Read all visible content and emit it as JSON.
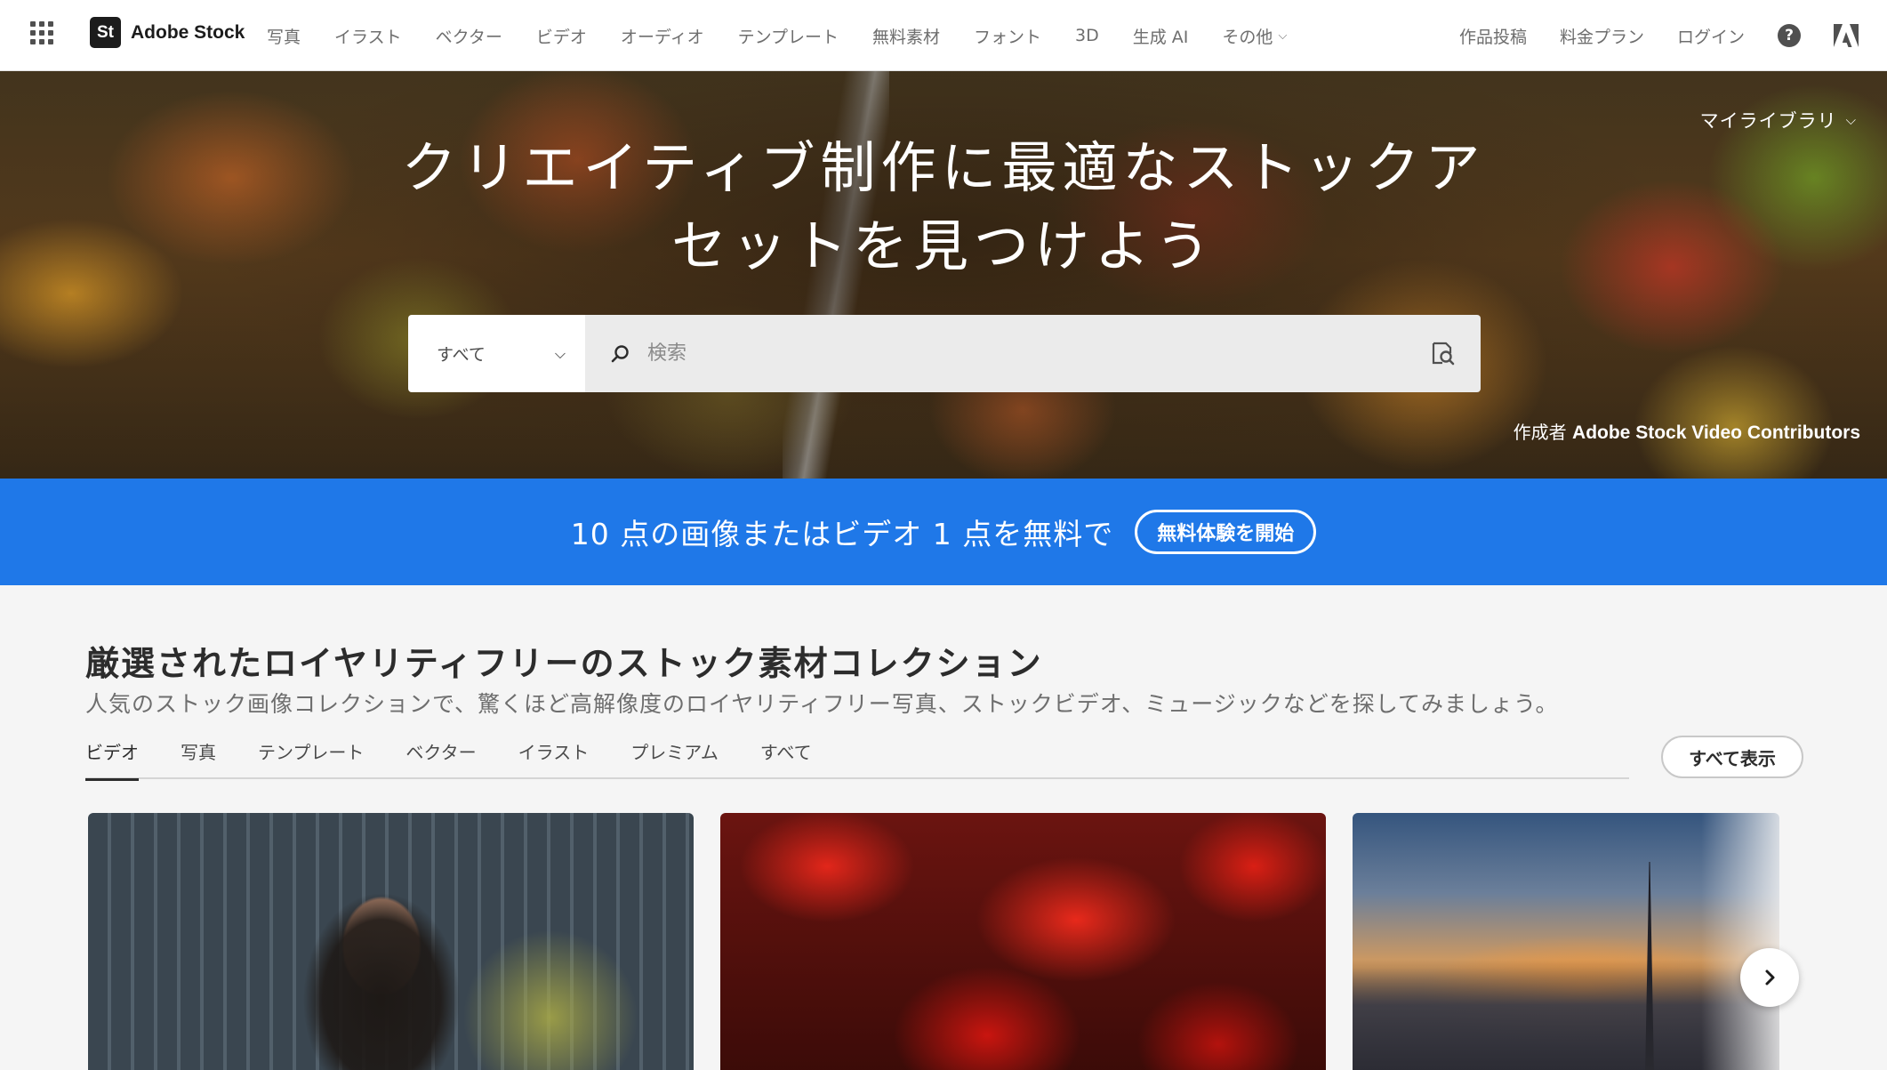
{
  "nav": {
    "logo_badge": "St",
    "logo_text": "Adobe Stock",
    "items": [
      "写真",
      "イラスト",
      "ベクター",
      "ビデオ",
      "オーディオ",
      "テンプレート",
      "無料素材",
      "フォント",
      "3D",
      "生成 AI",
      "その他"
    ],
    "right_items": [
      "作品投稿",
      "料金プラン",
      "ログイン"
    ],
    "help_label": "?"
  },
  "hero": {
    "title_line1": "クリエイティブ制作に最適なストックア",
    "title_line2": "セットを見つけよう",
    "library_label": "マイライブラリ",
    "search_type": "すべて",
    "search_placeholder": "検索",
    "credit_prefix": "作成者",
    "credit_name": "Adobe Stock Video Contributors"
  },
  "promo": {
    "text": "10 点の画像またはビデオ 1 点を無料で",
    "button": "無料体験を開始"
  },
  "collection": {
    "title": "厳選されたロイヤリティフリーのストック素材コレクション",
    "subtitle": "人気のストック画像コレクションで、驚くほど高解像度のロイヤリティフリー写真、ストックビデオ、ミュージックなどを探してみましょう。",
    "tabs": [
      "ビデオ",
      "写真",
      "テンプレート",
      "ベクター",
      "イラスト",
      "プレミアム",
      "すべて"
    ],
    "active_tab": "ビデオ",
    "show_all": "すべて表示"
  },
  "colors": {
    "promo_blue": "#1f78e8",
    "text_dark": "#2c2c2c",
    "text_muted": "#6e6e6e"
  },
  "icons": [
    "app-grid-icon",
    "chevron-down-icon",
    "help-icon",
    "adobe-logo-icon",
    "search-icon",
    "visual-search-icon",
    "chevron-right-icon"
  ]
}
